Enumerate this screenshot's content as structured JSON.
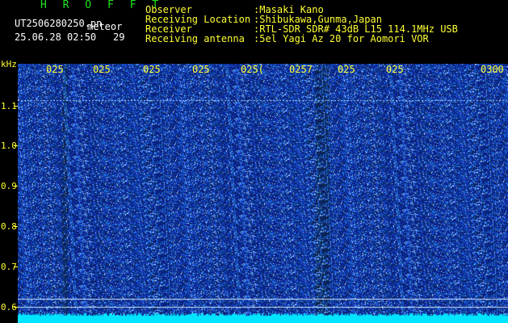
{
  "header": {
    "brand": "H R O F F T",
    "filename": "UT2506280250.pn",
    "category": "meteor",
    "datetime": "25.06.28 02:50",
    "count": "29",
    "info_labels": [
      "Observer",
      "Receiving Location",
      "Receiver",
      "Receiving antenna"
    ],
    "info_values": [
      ":Masaki Kano",
      ":Shibukawa,Gunma,Japan",
      ":RTL-SDR SDR# 43dB L15 114.1MHz USB",
      ":5el Yagi Az 20 for Aomori VOR"
    ]
  },
  "axes": {
    "y_unit": "kHz",
    "y_ticks": [
      "1.1",
      "1.0",
      "0.9",
      "0.8",
      "0.7",
      "0.6"
    ],
    "y_values": [
      1.1,
      1.0,
      0.9,
      0.8,
      0.7,
      0.6
    ],
    "time_labels": [
      "025",
      "025",
      "025",
      "025",
      "025(",
      "0257",
      "025",
      "025",
      "0300"
    ]
  },
  "colors": {
    "background": "#000000",
    "text_yellow": "#ffff33",
    "brand_green": "#1fe21f",
    "noise_blue": "#1a2fd6",
    "signal_cyan": "#00e5ff"
  }
}
